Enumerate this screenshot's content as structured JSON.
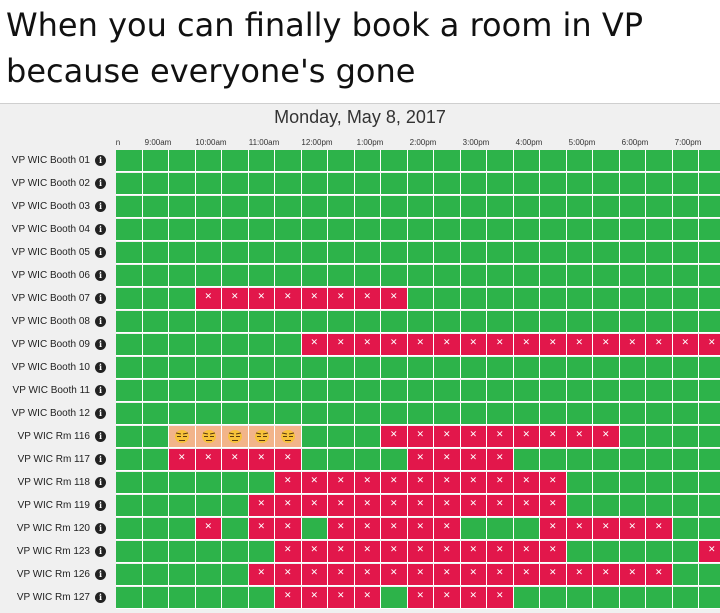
{
  "caption": {
    "line1": "When you can finally book a room in VP",
    "line2": "because everyone's gone"
  },
  "calendar": {
    "date": "Monday, May 8, 2017",
    "hours": [
      "n",
      "9:00am",
      "10:00am",
      "11:00am",
      "12:00pm",
      "1:00pm",
      "2:00pm",
      "3:00pm",
      "4:00pm",
      "5:00pm",
      "6:00pm",
      "7:00pm"
    ],
    "info_icon": "info-circle-icon",
    "colors": {
      "available": "#2db34a",
      "booked": "#e2174b",
      "emoji_bg": "#f2b48a"
    },
    "emoji": "unamused-face-icon",
    "slot_count": 23,
    "rooms": [
      {
        "name": "VP WIC Booth 01",
        "booked": [],
        "emoji": []
      },
      {
        "name": "VP WIC Booth 02",
        "booked": [],
        "emoji": []
      },
      {
        "name": "VP WIC Booth 03",
        "booked": [],
        "emoji": []
      },
      {
        "name": "VP WIC Booth 04",
        "booked": [],
        "emoji": []
      },
      {
        "name": "VP WIC Booth 05",
        "booked": [],
        "emoji": []
      },
      {
        "name": "VP WIC Booth 06",
        "booked": [],
        "emoji": []
      },
      {
        "name": "VP WIC Booth 07",
        "booked": [
          3,
          4,
          5,
          6,
          7,
          8,
          9,
          10
        ],
        "emoji": []
      },
      {
        "name": "VP WIC Booth 08",
        "booked": [],
        "emoji": []
      },
      {
        "name": "VP WIC Booth 09",
        "booked": [
          7,
          8,
          9,
          10,
          11,
          12,
          13,
          14,
          15,
          16,
          17,
          18,
          19,
          20,
          21,
          22
        ],
        "emoji": []
      },
      {
        "name": "VP WIC Booth 10",
        "booked": [],
        "emoji": []
      },
      {
        "name": "VP WIC Booth 11",
        "booked": [],
        "emoji": []
      },
      {
        "name": "VP WIC Booth 12",
        "booked": [],
        "emoji": []
      },
      {
        "name": "VP WIC Rm 116",
        "booked": [
          10,
          11,
          12,
          13,
          14,
          15,
          16,
          17,
          18
        ],
        "emoji": [
          2,
          3,
          4,
          5,
          6
        ]
      },
      {
        "name": "VP WIC Rm 117",
        "booked": [
          2,
          3,
          4,
          5,
          6,
          11,
          12,
          13,
          14
        ],
        "emoji": []
      },
      {
        "name": "VP WIC Rm 118",
        "booked": [
          6,
          7,
          8,
          9,
          10,
          11,
          12,
          13,
          14,
          15,
          16
        ],
        "emoji": []
      },
      {
        "name": "VP WIC Rm 119",
        "booked": [
          5,
          6,
          7,
          8,
          9,
          10,
          11,
          12,
          13,
          14,
          15,
          16
        ],
        "emoji": []
      },
      {
        "name": "VP WIC Rm 120",
        "booked": [
          3,
          5,
          6,
          8,
          9,
          10,
          11,
          12,
          16,
          17,
          18,
          19,
          20
        ],
        "emoji": []
      },
      {
        "name": "VP WIC Rm 123",
        "booked": [
          6,
          7,
          8,
          9,
          10,
          11,
          12,
          13,
          14,
          15,
          16,
          22
        ],
        "emoji": []
      },
      {
        "name": "VP WIC Rm 126",
        "booked": [
          5,
          6,
          7,
          8,
          9,
          10,
          11,
          12,
          13,
          14,
          15,
          16,
          17,
          18,
          19,
          20
        ],
        "emoji": []
      },
      {
        "name": "VP WIC Rm 127",
        "booked": [
          6,
          7,
          8,
          9,
          11,
          12,
          13,
          14
        ],
        "emoji": []
      }
    ]
  }
}
